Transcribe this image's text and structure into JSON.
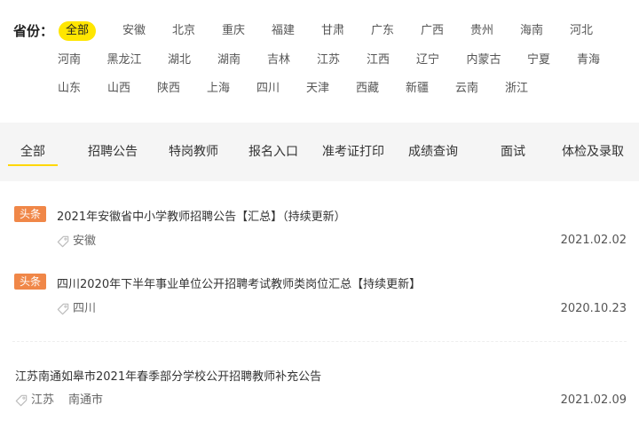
{
  "provinces": {
    "label": "省份：",
    "rows": [
      [
        "全部",
        "安徽",
        "北京",
        "重庆",
        "福建",
        "甘肃",
        "广东",
        "广西",
        "贵州",
        "海南",
        "河北"
      ],
      [
        "河南",
        "黑龙江",
        "湖北",
        "湖南",
        "吉林",
        "江苏",
        "江西",
        "辽宁",
        "内蒙古",
        "宁夏",
        "青海"
      ],
      [
        "山东",
        "山西",
        "陕西",
        "上海",
        "四川",
        "天津",
        "西藏",
        "新疆",
        "云南",
        "浙江"
      ]
    ],
    "active": "全部"
  },
  "tabs": [
    "全部",
    "招聘公告",
    "特岗教师",
    "报名入口",
    "准考证打印",
    "成绩查询",
    "面试",
    "体检及录取"
  ],
  "articles": [
    {
      "badge": "头条",
      "title": "2021年安徽省中小学教师招聘公告【汇总】（持续更新）",
      "tags": [
        "安徽"
      ],
      "date": "2021.02.02"
    },
    {
      "badge": "头条",
      "title": "四川2020年下半年事业单位公开招聘考试教师类岗位汇总【持续更新】",
      "tags": [
        "四川"
      ],
      "date": "2020.10.23"
    },
    {
      "badge": "",
      "title": "江苏南通如皋市2021年春季部分学校公开招聘教师补充公告",
      "tags": [
        "江苏",
        "南通市"
      ],
      "date": "2021.02.09"
    }
  ],
  "colors": {
    "active_pill": "#ffe600",
    "badge": "#f08748",
    "tab_bg": "#f5f5f5",
    "tab_underline": "#ffd700"
  },
  "icons": {
    "tag": "tag-icon"
  }
}
